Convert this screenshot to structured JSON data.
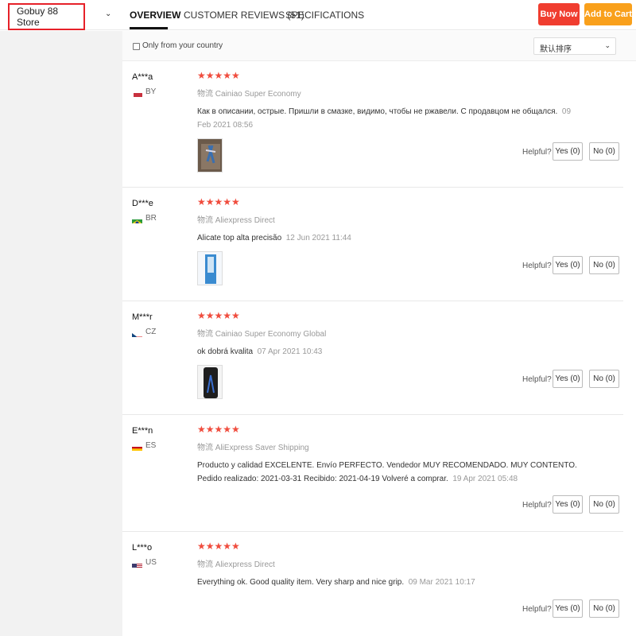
{
  "header": {
    "store_name": "Gobuy 88 Store",
    "tabs": [
      {
        "label": "OVERVIEW",
        "active": true
      },
      {
        "label": "CUSTOMER REVIEWS (51)",
        "active": false
      },
      {
        "label": "SPECIFICATIONS",
        "active": false
      }
    ],
    "buy_now": "Buy Now",
    "add_to_cart": "Add to Cart"
  },
  "filter": {
    "country_only_label": "Only from your country",
    "sort_value": "默认排序"
  },
  "helpful_label": "Helpful?",
  "reviews": [
    {
      "name": "A***a",
      "country": "BY",
      "stars": "★★★★★",
      "shipping_prefix": "物流",
      "shipping": "Cainiao Super Economy",
      "text": "Как в описании, острые. Пришли в смазке, видимо, чтобы не ржавели. С продавцом не общался.",
      "date": "09 Feb 2021 08:56",
      "yes": "Yes (0)",
      "no": "No (0)"
    },
    {
      "name": "D***e",
      "country": "BR",
      "stars": "★★★★★",
      "shipping_prefix": "物流",
      "shipping": "Aliexpress Direct",
      "text": "Alicate top alta precisão",
      "date": "12 Jun 2021 11:44",
      "yes": "Yes (0)",
      "no": "No (0)"
    },
    {
      "name": "M***r",
      "country": "CZ",
      "stars": "★★★★★",
      "shipping_prefix": "物流",
      "shipping": "Cainiao Super Economy Global",
      "text": "ok dobrá kvalita",
      "date": "07 Apr 2021 10:43",
      "yes": "Yes (0)",
      "no": "No (0)"
    },
    {
      "name": "E***n",
      "country": "ES",
      "stars": "★★★★★",
      "shipping_prefix": "物流",
      "shipping": "AliExpress Saver Shipping",
      "text": "Producto y calidad EXCELENTE. Envío PERFECTO. Vendedor MUY RECOMENDADO. MUY CONTENTO. Pedido realizado: 2021-03-31 Recibido: 2021-04-19 Volveré a comprar.",
      "date": "19 Apr 2021 05:48",
      "yes": "Yes (0)",
      "no": "No (0)"
    },
    {
      "name": "L***o",
      "country": "US",
      "stars": "★★★★★",
      "shipping_prefix": "物流",
      "shipping": "Aliexpress Direct",
      "text": "Everything ok. Good quality item. Very sharp and nice grip.",
      "date": "09 Mar 2021 10:17",
      "yes": "Yes (0)",
      "no": "No (0)"
    }
  ],
  "colors": {
    "buy_now": "#f03d2f",
    "add_to_cart": "#f9a01b",
    "stars": "#f04c3d",
    "store_highlight": "#e62129"
  }
}
